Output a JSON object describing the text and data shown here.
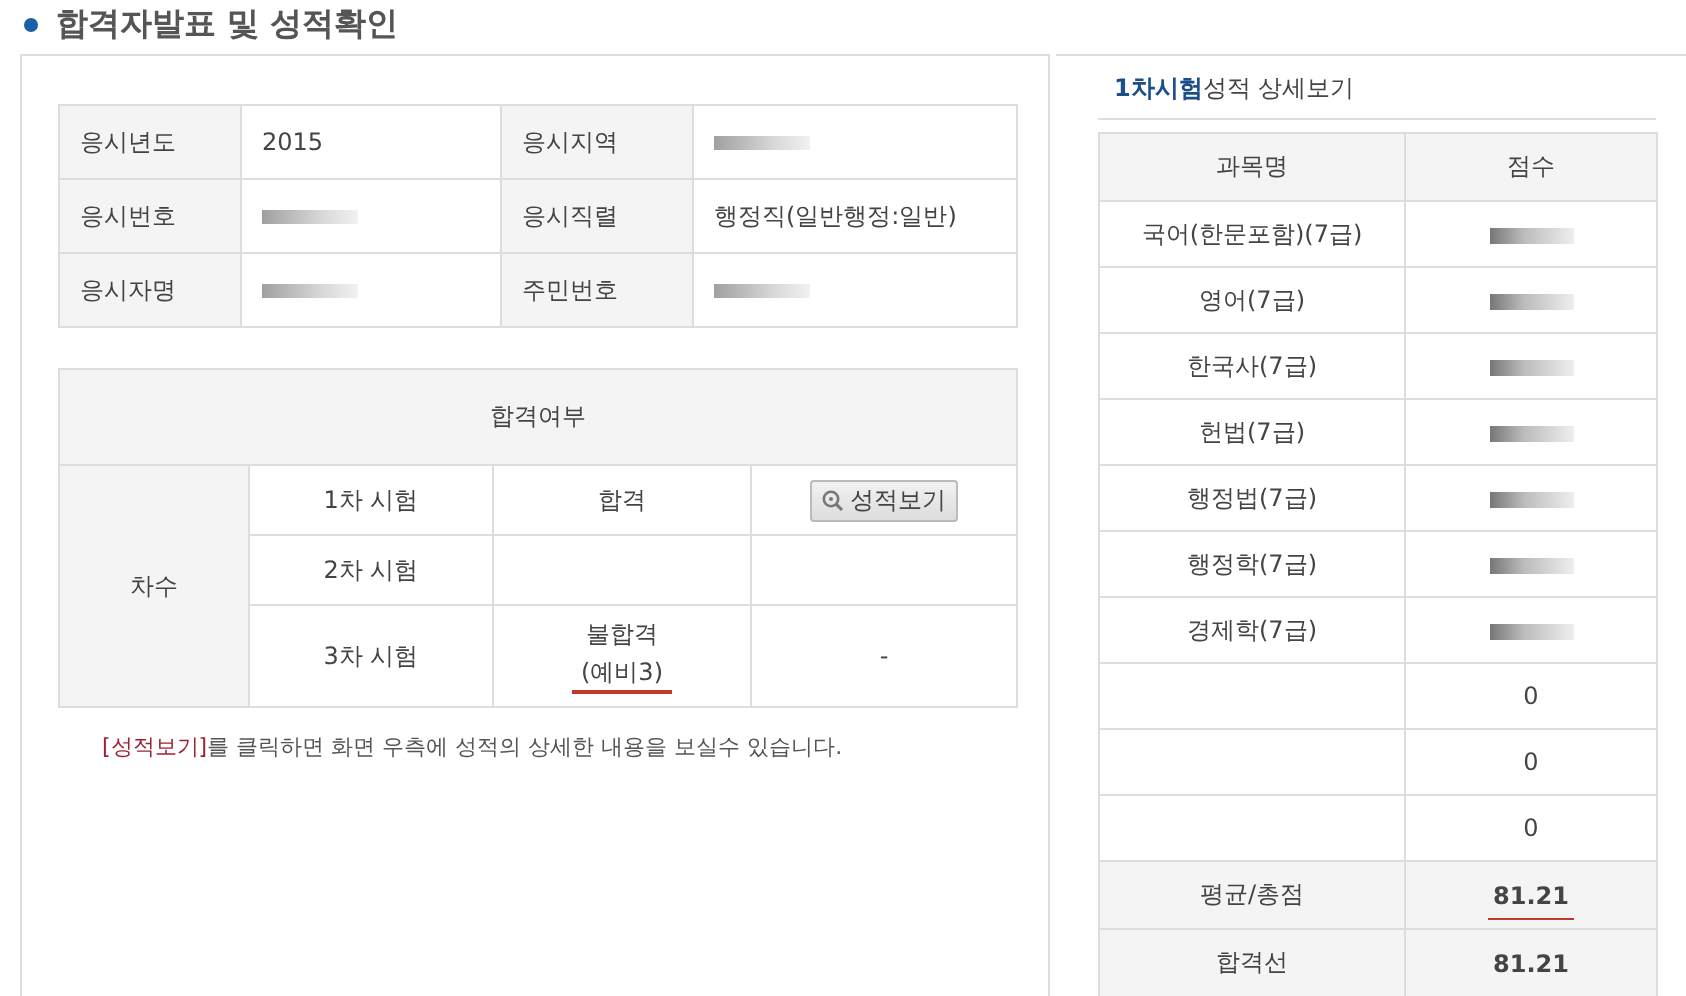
{
  "page_title": "합격자발표 및 성적확인",
  "applicant": {
    "rows": [
      {
        "label_1": "응시년도",
        "value_1": "2015",
        "redacted_1": false,
        "label_2": "응시지역",
        "value_2": "",
        "redacted_2": true
      },
      {
        "label_1": "응시번호",
        "value_1": "",
        "redacted_1": true,
        "label_2": "응시직렬",
        "value_2": "행정직(일반행정:일반)",
        "redacted_2": false
      },
      {
        "label_1": "응시자명",
        "value_1": "",
        "redacted_1": true,
        "label_2": "주민번호",
        "value_2": "",
        "redacted_2": true
      }
    ]
  },
  "result": {
    "header": "합격여부",
    "group_label": "차수",
    "rows": [
      {
        "stage": "1차 시험",
        "result": "합격",
        "action": "성적보기",
        "action_text": ""
      },
      {
        "stage": "2차 시험",
        "result": "",
        "action": "",
        "action_text": ""
      },
      {
        "stage": "3차 시험",
        "result": "불합격",
        "result_note": {
          "text": "(예비3)",
          "underlined": true
        },
        "action": "",
        "action_text": "-"
      }
    ]
  },
  "note": {
    "link": "[성적보기]",
    "text": "를 클릭하면 화면 우측에 성적의 상세한 내용을 보실수 있습니다."
  },
  "detail": {
    "title_strong": "1차시험",
    "title_rest": "성적 상세보기",
    "columns": [
      "과목명",
      "점수"
    ],
    "rows": [
      {
        "subject": "국어(한문포함)(7급)",
        "score": "",
        "redacted": true
      },
      {
        "subject": "영어(7급)",
        "score": "",
        "redacted": true
      },
      {
        "subject": "한국사(7급)",
        "score": "",
        "redacted": true
      },
      {
        "subject": "헌법(7급)",
        "score": "",
        "redacted": true
      },
      {
        "subject": "행정법(7급)",
        "score": "",
        "redacted": true
      },
      {
        "subject": "행정학(7급)",
        "score": "",
        "redacted": true
      },
      {
        "subject": "경제학(7급)",
        "score": "",
        "redacted": true
      },
      {
        "subject": "",
        "score": "0",
        "redacted": false
      },
      {
        "subject": "",
        "score": "0",
        "redacted": false
      },
      {
        "subject": "",
        "score": "0",
        "redacted": false
      }
    ],
    "summary": [
      {
        "label": "평균/총점",
        "value": "81.21",
        "underlined": true
      },
      {
        "label": "합격선",
        "value": "81.21",
        "underlined": false
      }
    ]
  }
}
